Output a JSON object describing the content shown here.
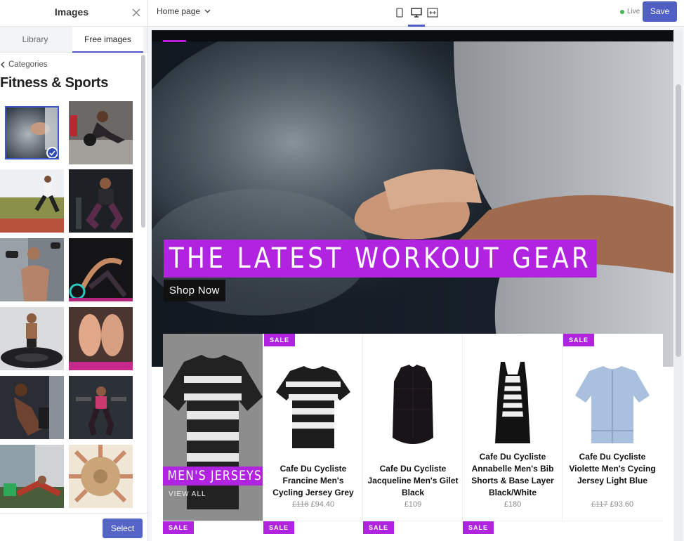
{
  "panel": {
    "title": "Images",
    "tabs": [
      {
        "label": "Library"
      },
      {
        "label": "Free images"
      }
    ],
    "back_label": "Categories",
    "category_title": "Fitness & Sports",
    "select_label": "Select"
  },
  "topbar": {
    "page": "Home page",
    "live_label": "Live",
    "save_label": "Save"
  },
  "hero": {
    "headline": "THE LATEST WORKOUT GEAR",
    "cta": "Shop Now"
  },
  "products": {
    "feature": {
      "label": "MEN'S JERSEYS",
      "link": "VIEW ALL"
    },
    "sale_label": "SALE",
    "items": [
      {
        "name": "Cafe Du Cycliste Francine Men's Cycling Jersey Grey",
        "old_price": "£118",
        "price": "£94.40",
        "sale": false
      },
      {
        "name": "Cafe Du Cycliste Jacqueline Men's Gilet Black",
        "old_price": "",
        "price": "£109",
        "sale": false
      },
      {
        "name": "Cafe Du Cycliste Annabelle Men's Bib Shorts & Base Layer Black/White",
        "old_price": "",
        "price": "£180",
        "sale": false
      },
      {
        "name": "Cafe Du Cycliste Violette Men's Cycing Jersey Light Blue",
        "old_price": "£117",
        "price": "£93.60",
        "sale": true
      }
    ]
  },
  "colors": {
    "accent": "#b024e0",
    "button": "#4f5fc4",
    "live": "#3fb950"
  }
}
